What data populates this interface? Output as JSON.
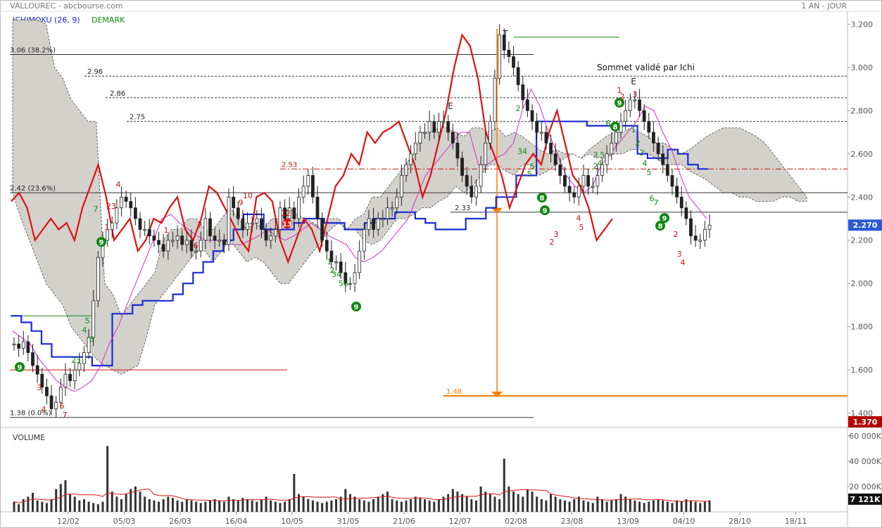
{
  "header": {
    "title": "VALLOUREC - abcbourse.com",
    "period": "1 AN - JOUR",
    "indicator1": "ICHIMOKU (26, 9)",
    "indicator2": "DEMARK"
  },
  "colors": {
    "price_line": "#dd1111",
    "kijun": "#1a2bd6",
    "tenkan": "#cc33cc",
    "cloud_fill": "#cfcdc6",
    "up_label": "#118811",
    "down_label": "#cc1111",
    "target": "#ff7f00",
    "current_price_box": "#2b59d8",
    "low_price_box": "#b30000"
  },
  "chart_data": [
    {
      "type": "candlestick",
      "title": "VALLOUREC - abcbourse.com",
      "ylabel": "",
      "ylim": [
        1.34,
        3.26
      ],
      "y_ticks": [
        "3.200",
        "3.000",
        "2.800",
        "2.600",
        "2.400",
        "2.200",
        "2.000",
        "1.800",
        "1.600",
        "1.400"
      ],
      "x_ticks": [
        "12/02",
        "05/03",
        "26/03",
        "16/04",
        "10/05",
        "31/05",
        "21/06",
        "12/07",
        "02/08",
        "23/08",
        "13/09",
        "04/10",
        "28/10",
        "18/11"
      ],
      "current_price_label": "2.270",
      "low_price_label": "1.370",
      "annotations": {
        "top_label": "T",
        "e_label_1": "E",
        "e_label_2": "E",
        "sommet": "Sommet validé par Ichi",
        "target": "1.48",
        "fib_1": "3.06  (38.2%)",
        "fib_2": "2.42  (23.6%)",
        "fib_3": "1.38  (0.0%)",
        "level_296": "2.96",
        "level_286": "2.86",
        "level_275": "2.75",
        "level_253": "2.53",
        "level_233": "2.33"
      },
      "levels": {
        "fib_38": 3.06,
        "fib_236": 2.42,
        "fib_0": 1.38,
        "l296": 2.96,
        "l286": 2.86,
        "l275": 2.75,
        "l253": 2.53,
        "l233": 2.33,
        "target": 1.48,
        "current": 2.27
      },
      "series": [
        {
          "name": "price",
          "values": [
            1.72,
            1.7,
            1.73,
            1.68,
            1.62,
            1.58,
            1.52,
            1.48,
            1.42,
            1.45,
            1.52,
            1.58,
            1.55,
            1.6,
            1.63,
            1.68,
            1.75,
            1.92,
            2.12,
            2.2,
            2.25,
            2.28,
            2.35,
            2.4,
            2.38,
            2.35,
            2.3,
            2.25,
            2.25,
            2.22,
            2.2,
            2.18,
            2.15,
            2.2,
            2.2,
            2.22,
            2.18,
            2.2,
            2.15,
            2.15,
            2.2,
            2.3,
            2.22,
            2.2,
            2.2,
            2.18,
            2.4,
            2.35,
            2.3,
            2.25,
            2.28,
            2.28,
            2.3,
            2.25,
            2.2,
            2.22,
            2.25,
            2.35,
            2.3,
            2.35,
            2.3,
            2.4,
            2.45,
            2.5,
            2.4,
            2.3,
            2.2,
            2.15,
            2.1,
            2.1,
            2.05,
            2.0,
            2.0,
            2.05,
            2.15,
            2.25,
            2.3,
            2.25,
            2.3,
            2.3,
            2.35,
            2.35,
            2.4,
            2.5,
            2.55,
            2.6,
            2.65,
            2.7,
            2.7,
            2.75,
            2.7,
            2.75,
            2.75,
            2.7,
            2.65,
            2.58,
            2.5,
            2.45,
            2.4,
            2.45,
            2.55,
            2.65,
            2.75,
            2.95,
            3.15,
            3.08,
            3.05,
            3.0,
            2.92,
            2.85,
            2.8,
            2.75,
            2.7,
            2.7,
            2.65,
            2.6,
            2.55,
            2.5,
            2.45,
            2.42,
            2.4,
            2.45,
            2.5,
            2.45,
            2.45,
            2.5,
            2.55,
            2.6,
            2.65,
            2.7,
            2.75,
            2.8,
            2.85,
            2.85,
            2.8,
            2.75,
            2.7,
            2.65,
            2.6,
            2.55,
            2.5,
            2.45,
            2.4,
            2.35,
            2.3,
            2.22,
            2.2,
            2.2,
            2.25,
            2.27
          ]
        },
        {
          "name": "volume",
          "values": [
            8,
            6,
            10,
            12,
            15,
            9,
            8,
            7,
            10,
            18,
            22,
            25,
            14,
            12,
            9,
            10,
            8,
            7,
            6,
            8,
            52,
            16,
            12,
            10,
            14,
            18,
            20,
            16,
            12,
            10,
            9,
            8,
            10,
            12,
            11,
            9,
            8,
            10,
            9,
            8,
            7,
            8,
            9,
            10,
            9,
            8,
            12,
            10,
            9,
            11,
            10,
            9,
            8,
            10,
            12,
            9,
            8,
            7,
            8,
            10,
            30,
            14,
            12,
            10,
            9,
            8,
            7,
            8,
            9,
            10,
            12,
            18,
            14,
            12,
            10,
            9,
            8,
            10,
            12,
            14,
            16,
            10,
            9,
            8,
            9,
            10,
            12,
            11,
            10,
            9,
            8,
            10,
            12,
            14,
            18,
            16,
            14,
            12,
            10,
            9,
            20,
            16,
            14,
            12,
            10,
            42,
            20,
            16,
            14,
            12,
            18,
            16,
            12,
            10,
            9,
            14,
            12,
            10,
            9,
            8,
            10,
            12,
            9,
            8,
            7,
            12,
            10,
            8,
            9,
            10,
            14,
            12,
            10,
            9,
            8,
            7,
            8,
            9,
            10,
            9,
            8,
            7,
            9,
            8,
            10,
            9,
            8,
            7,
            8,
            9
          ]
        }
      ],
      "volume_axis": [
        "60 000K",
        "40 000K",
        "20 000K"
      ],
      "volume_label": "VOLUME",
      "volume_current": "7 121K"
    }
  ]
}
